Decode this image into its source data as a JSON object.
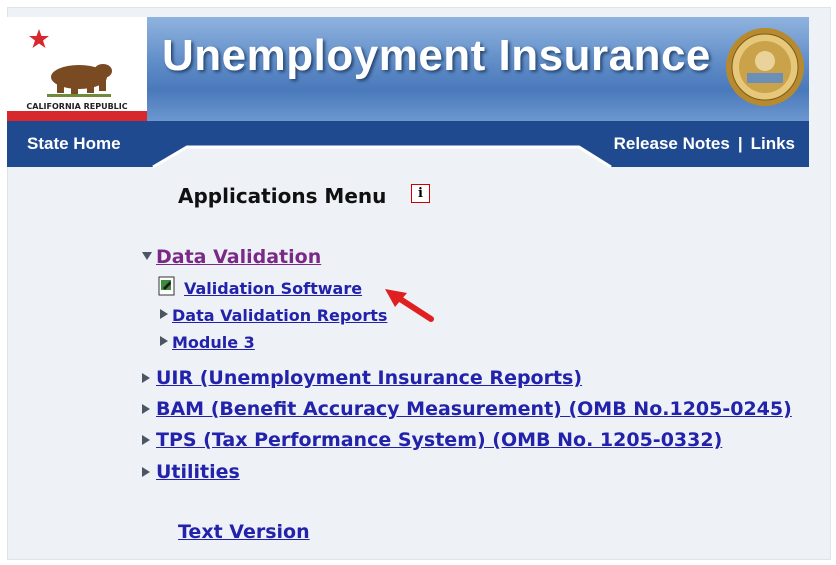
{
  "banner": {
    "flag_text": "CALIFORNIA REPUBLIC",
    "title": "Unemployment Insurance"
  },
  "nav": {
    "state_home": "State Home",
    "release_notes": "Release Notes",
    "separator": "|",
    "links": "Links"
  },
  "menu": {
    "title": "Applications Menu",
    "info_glyph": "i",
    "data_validation": "Data Validation",
    "validation_software": "Validation Software",
    "dv_reports": "Data Validation Reports",
    "module3": "Module 3",
    "uir": "UIR (Unemployment Insurance Reports)",
    "bam": "BAM (Benefit Accuracy Measurement) (OMB No.1205-0245)",
    "tps": "TPS (Tax Performance System) (OMB No. 1205-0332)",
    "utilities": "Utilities",
    "text_version": "Text Version"
  },
  "colors": {
    "link": "#2222aa",
    "visited_link": "#7a2a86",
    "nav_bar": "#1f4a8f",
    "arrow": "#e02020"
  },
  "icons": [
    "california-flag-icon",
    "state-seal-icon",
    "info-icon",
    "document-icon",
    "red-arrow-icon",
    "expand-arrow-icon",
    "collapse-arrow-icon"
  ]
}
